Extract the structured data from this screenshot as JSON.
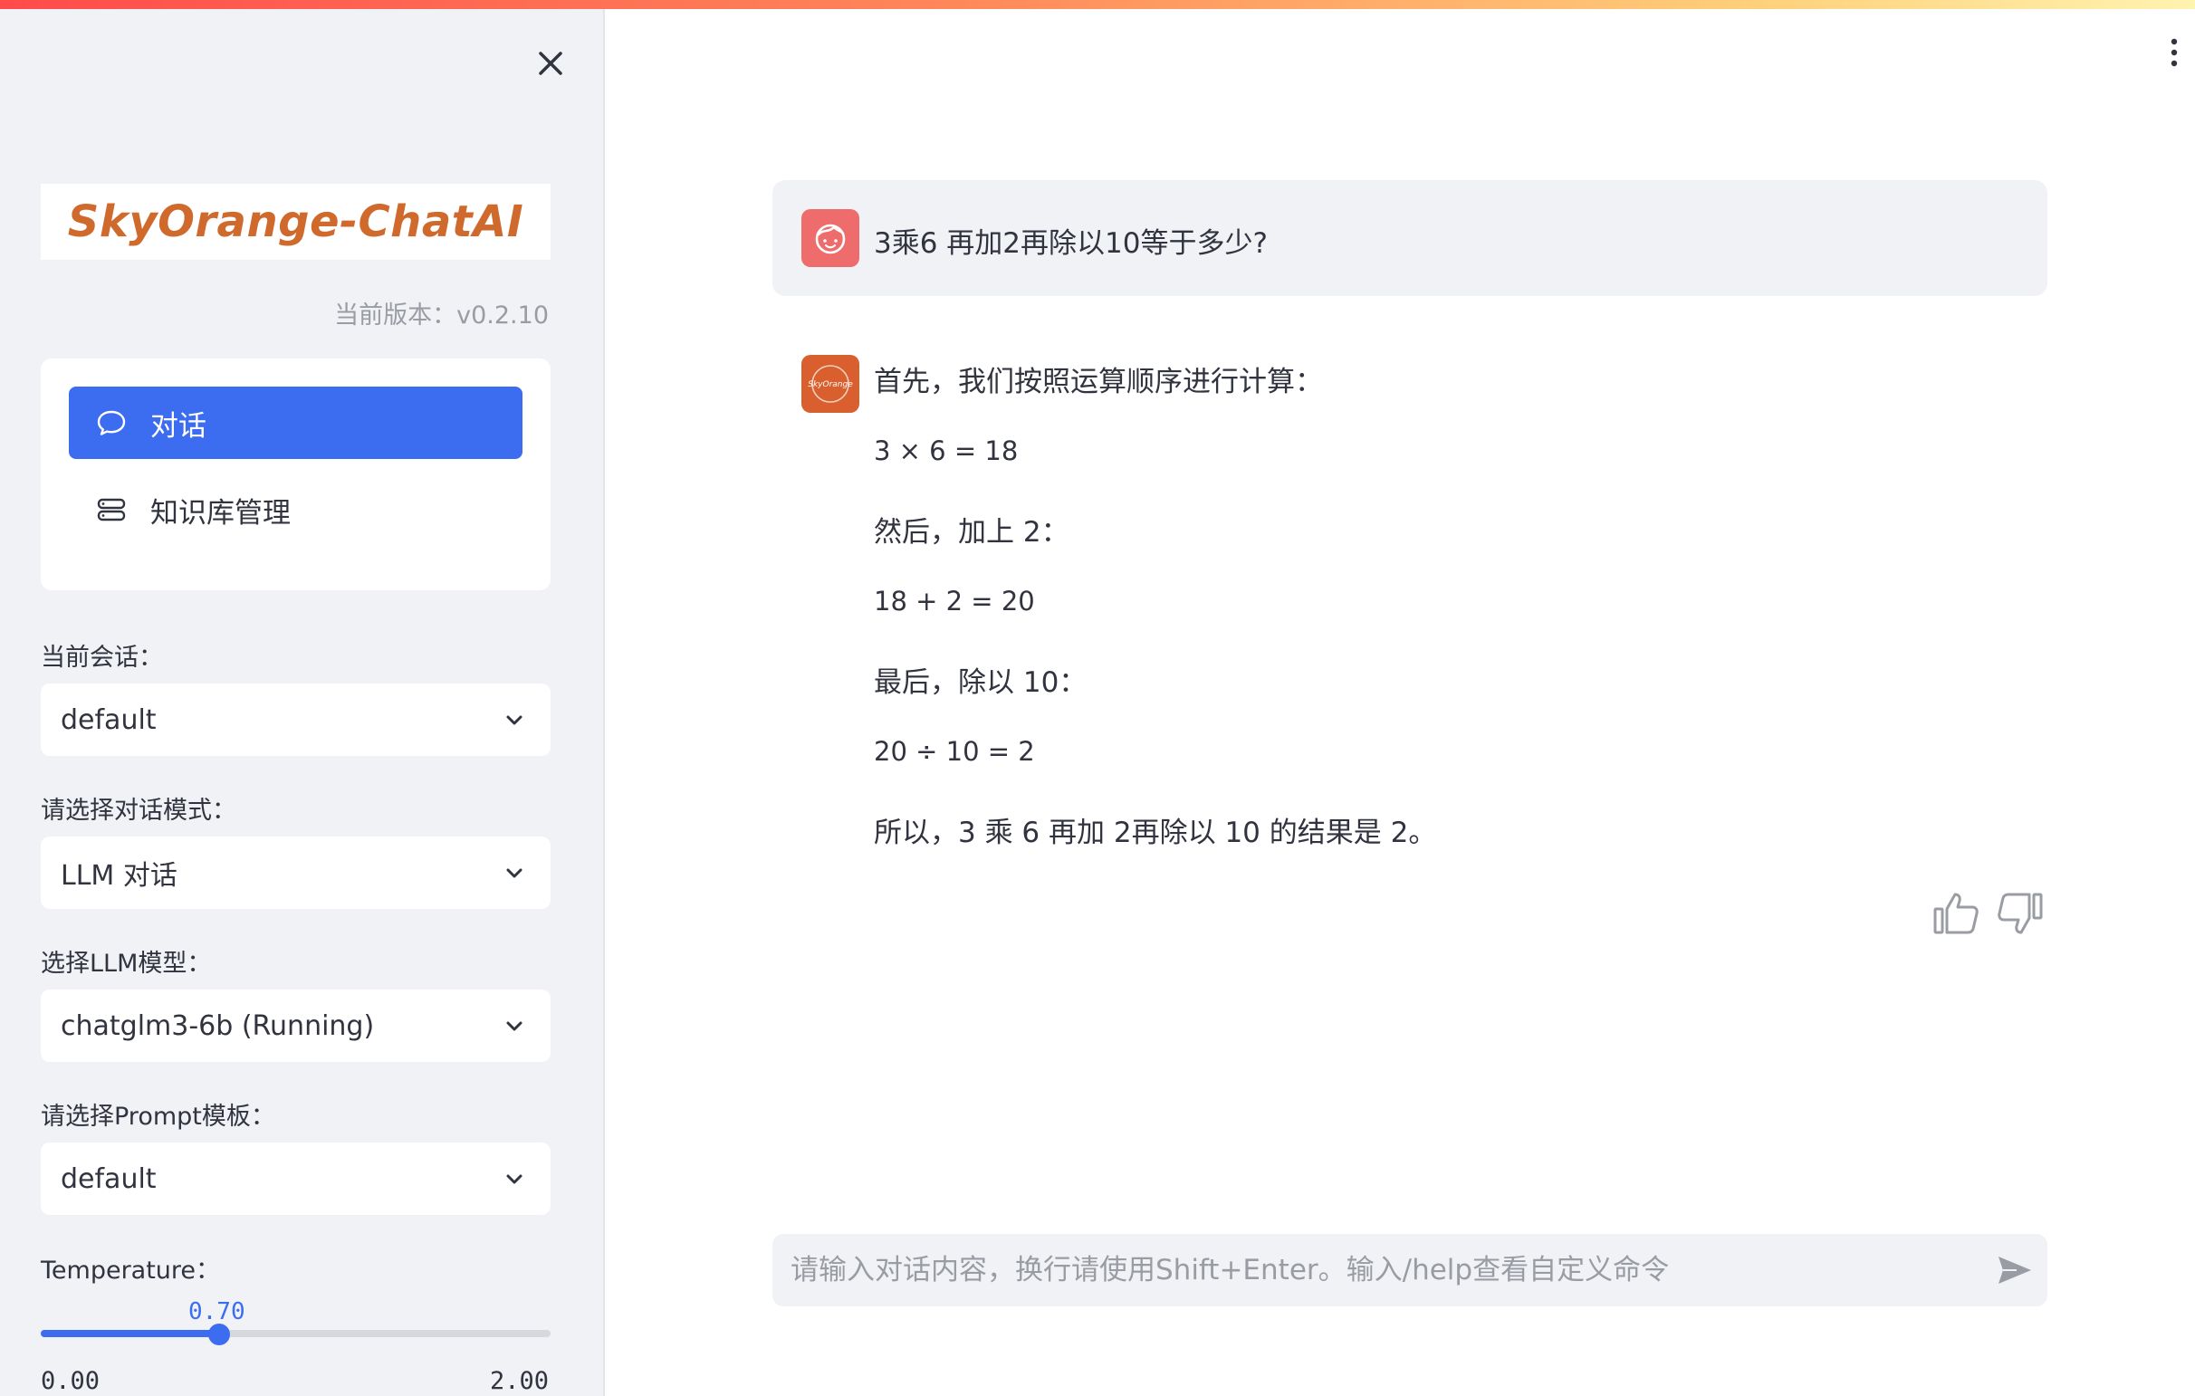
{
  "sidebar": {
    "logo_text": "SkyOrange-ChatAI",
    "version": "当前版本：v0.2.10",
    "nav": [
      {
        "label": "对话",
        "icon": "chat-bubble-icon"
      },
      {
        "label": "知识库管理",
        "icon": "database-icon"
      }
    ],
    "session": {
      "label": "当前会话：",
      "value": "default"
    },
    "mode": {
      "label": "请选择对话模式：",
      "value": "LLM 对话"
    },
    "model": {
      "label": "选择LLM模型：",
      "value": "chatglm3-6b (Running)"
    },
    "prompt": {
      "label": "请选择Prompt模板：",
      "value": "default"
    },
    "temperature": {
      "label": "Temperature：",
      "value": "0.70",
      "min": "0.00",
      "max": "2.00",
      "fraction": 0.35
    }
  },
  "chat": {
    "user_message": "3乘6 再加2再除以10等于多少?",
    "assistant_lines": [
      "首先，我们按照运算顺序进行计算：",
      "3 × 6 = 18",
      "然后，加上 2：",
      "18 + 2 = 20",
      "最后，除以 10：",
      "20 ÷ 10 = 2",
      "所以，3 乘 6 再加 2再除以 10 的结果是 2。"
    ],
    "bot_avatar_text": "SkyOrange",
    "input_placeholder": "请输入对话内容，换行请使用Shift+Enter。输入/help查看自定义命令"
  },
  "colors": {
    "accent": "#3c6cf0",
    "logo": "#cf6a2c",
    "user_avatar": "#ef6c6c",
    "bot_avatar": "#d9602e"
  }
}
